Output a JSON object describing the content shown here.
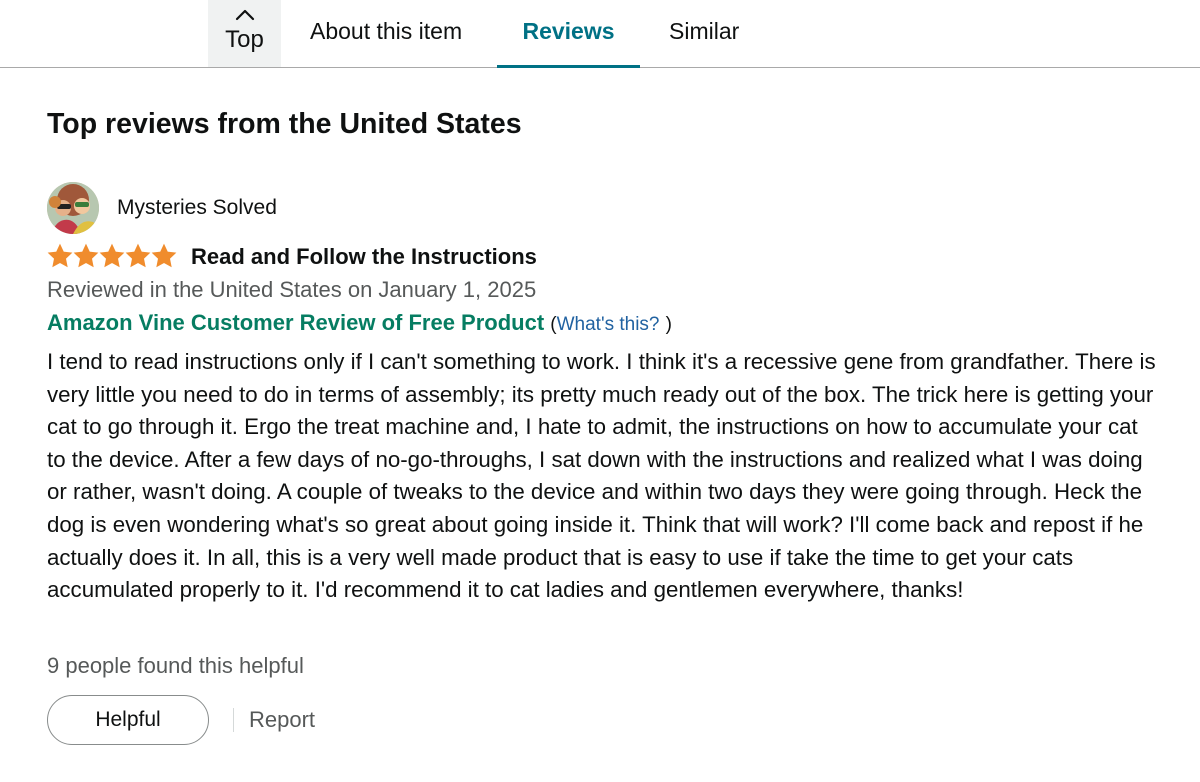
{
  "tabs": {
    "top_label": "Top",
    "about_label": "About this item",
    "reviews_label": "Reviews",
    "similar_label": "Similar",
    "active": "Reviews"
  },
  "section": {
    "title": "Top reviews from the United States"
  },
  "review": {
    "reviewer_name": "Mysteries Solved",
    "avatar_icon": "profile-avatar",
    "rating": 5,
    "rating_max": 5,
    "title": "Read and Follow the Instructions",
    "date_line": "Reviewed in the United States on January 1, 2025",
    "vine_label": "Amazon Vine Customer Review of Free Product",
    "vine_link_open": "(",
    "vine_link": "What's this?",
    "vine_link_close": ")",
    "body": "I tend to read instructions only if I can't something to work. I think it's a recessive gene from grandfather. There is very little you need to do in terms of assembly; its pretty much ready out of the box. The trick here is getting your cat to go through it. Ergo the treat machine and, I hate to admit, the instructions on how to accumulate your cat to the device. After a few days of no-go-throughs, I sat down with the instructions and realized what I was doing or rather, wasn't doing. A couple of tweaks to the device and within two days they were going through. Heck the dog is even wondering what's so great about going inside it. Think that will work? I'll come back and repost if he actually does it. In all, this is a very well made product that is easy to use if take the time to get your cats accumulated properly to it. I'd recommend it to cat ladies and gentlemen everywhere, thanks!",
    "helpful_count_text": "9 people found this helpful",
    "helpful_button": "Helpful",
    "report_link": "Report"
  },
  "colors": {
    "star": "#f08c2d",
    "active_tab": "#007185",
    "vine_green": "#067d62",
    "link_blue": "#2162a1",
    "secondary_text": "#565959"
  }
}
